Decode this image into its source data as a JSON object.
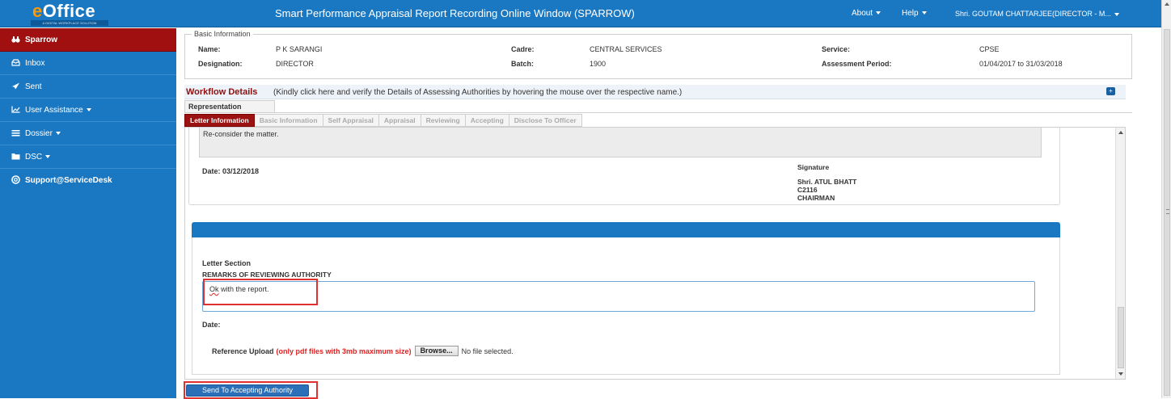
{
  "header": {
    "logo_text": "eOffice",
    "logo_tagline": "A DIGITAL WORKPLACE SOLUTION",
    "title": "Smart Performance Appraisal Report Recording Online Window (SPARROW)",
    "menu_about": "About",
    "menu_help": "Help",
    "user": "Shri. GOUTAM CHATTARJEE(DIRECTOR - M..."
  },
  "sidebar": {
    "items": [
      {
        "label": "Sparrow",
        "icon": "binoculars-icon"
      },
      {
        "label": "Inbox",
        "icon": "inbox-icon"
      },
      {
        "label": "Sent",
        "icon": "paper-plane-icon"
      },
      {
        "label": "User Assistance",
        "icon": "chart-icon"
      },
      {
        "label": "Dossier",
        "icon": "list-icon"
      },
      {
        "label": "DSC",
        "icon": "folder-icon"
      },
      {
        "label": "Support@ServiceDesk",
        "icon": "lifebuoy-icon"
      }
    ]
  },
  "basic_info": {
    "legend": "Basic Information",
    "name_label": "Name:",
    "name_value": "P K SARANGI",
    "designation_label": "Designation:",
    "designation_value": "DIRECTOR",
    "cadre_label": "Cadre:",
    "cadre_value": "CENTRAL SERVICES",
    "batch_label": "Batch:",
    "batch_value": "1900",
    "service_label": "Service:",
    "service_value": "CPSE",
    "period_label": "Assessment Period:",
    "period_value": "01/04/2017 to 31/03/2018"
  },
  "workflow": {
    "title": "Workflow Details",
    "text": "(Kindly click here and verify the Details of Assessing Authorities by hovering the mouse over the respective name.)",
    "expand_icon": "plus-icon"
  },
  "representation_tab": "Representation",
  "tabs": [
    {
      "label": "Letter Information"
    },
    {
      "label": "Basic Information"
    },
    {
      "label": "Self Appraisal"
    },
    {
      "label": "Appraisal"
    },
    {
      "label": "Reviewing"
    },
    {
      "label": "Accepting"
    },
    {
      "label": "Disclose To Officer"
    }
  ],
  "letter": {
    "previous_text": "Re-consider the matter.",
    "date": "Date: 03/12/2018",
    "signature_label": "Signature",
    "signer_name": "Shri. ATUL BHATT",
    "signer_code": "C2116",
    "signer_role": "CHAIRMAN"
  },
  "letter_section": {
    "title": "Letter Section",
    "remarks_heading": "REMARKS OF REVIEWING AUTHORITY",
    "remarks_value_word1": "Ok",
    "remarks_value_rest": " with the report.",
    "date_label": "Date:",
    "upload_label": "Reference Upload",
    "upload_note": "(only pdf files with 3mb maximum size)",
    "browse_label": "Browse...",
    "no_file_text": "No file selected."
  },
  "actions": {
    "send_label": "Send To Accepting Authority"
  },
  "colors": {
    "header_blue": "#1a78c2",
    "active_red": "#9a1212",
    "highlight_red": "#e03030"
  }
}
